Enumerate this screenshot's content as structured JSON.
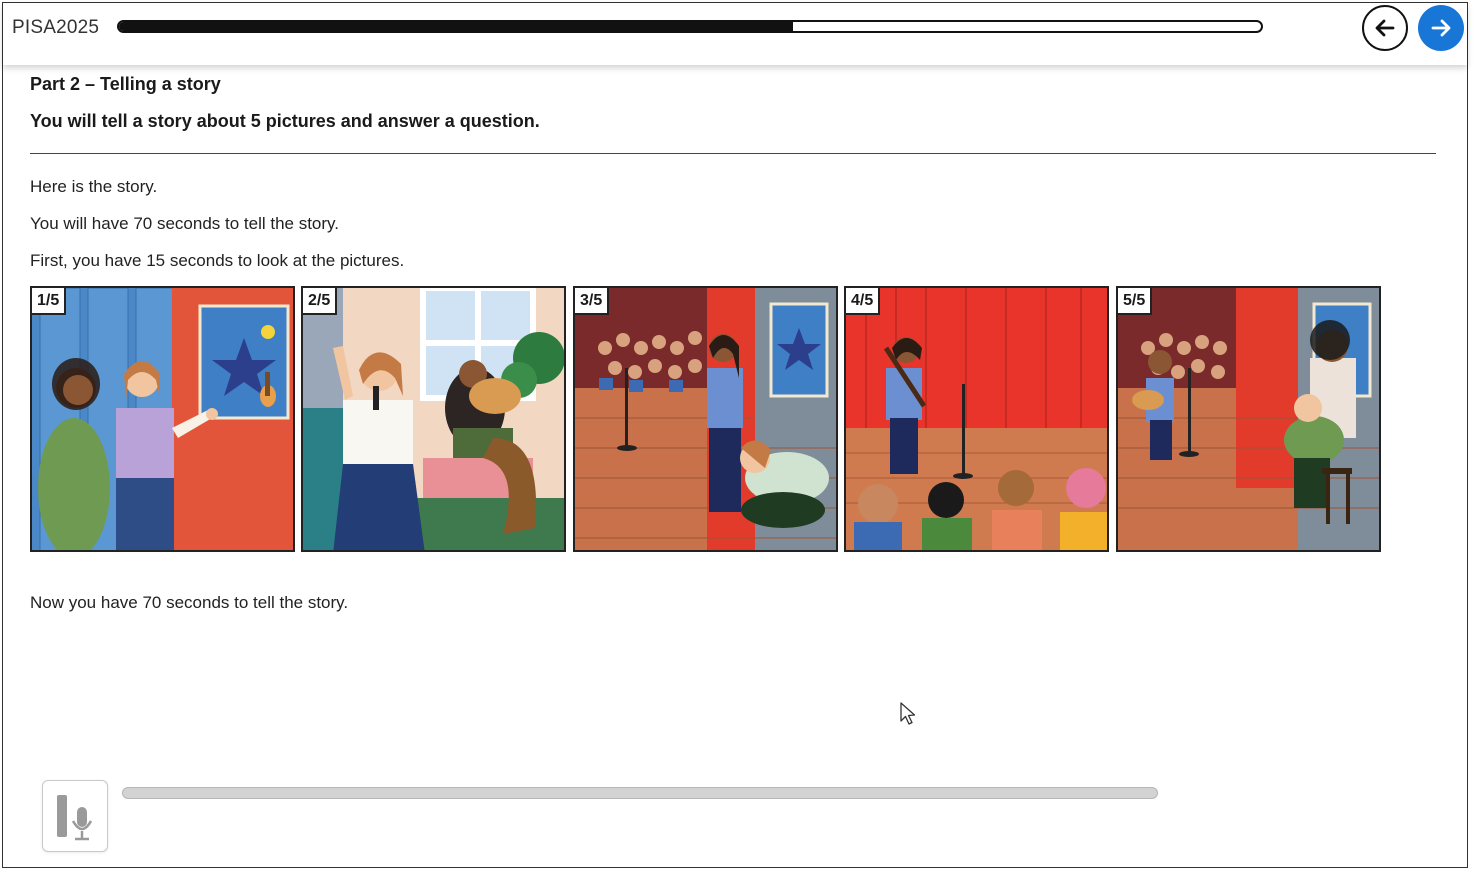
{
  "header": {
    "brand": "PISA2025",
    "progress_fraction": 0.59,
    "back_icon": "arrow-left-icon",
    "next_icon": "arrow-right-icon",
    "accent_color": "#1877d6"
  },
  "task": {
    "part_title": "Part 2 – Telling a story",
    "instruction": "You will tell a story about 5 pictures and answer a question.",
    "paragraphs": [
      "Here is the story.",
      "You will have 70 seconds to tell the story.",
      "First, you have 15 seconds to look at the pictures."
    ],
    "panels": [
      {
        "label": "1/5"
      },
      {
        "label": "2/5"
      },
      {
        "label": "3/5"
      },
      {
        "label": "4/5"
      },
      {
        "label": "5/5"
      }
    ],
    "prompt": "Now you have 70 seconds to tell the story."
  },
  "recorder": {
    "mic_icon": "microphone-icon",
    "level_fraction": 0
  }
}
